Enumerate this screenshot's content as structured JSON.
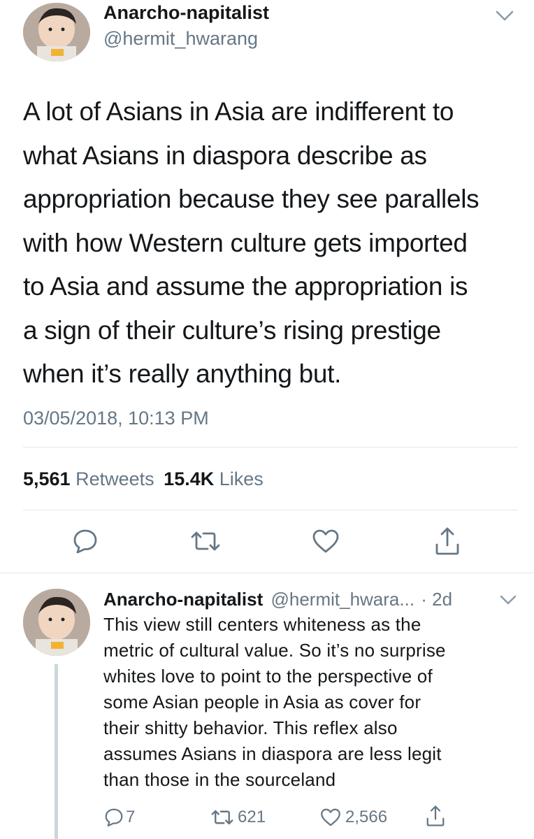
{
  "tweet": {
    "author_name": "Anarcho-napitalist",
    "author_handle": "@hermit_hwarang",
    "lines": [
      "A lot of Asians in Asia are indifferent to",
      "what Asians in diaspora describe as",
      "appropriation because they see parallels",
      "with how Western culture gets imported",
      "to Asia and assume the appropriation is",
      "a sign of their culture’s rising prestige",
      "when it’s really anything but."
    ],
    "timestamp": "03/05/2018, 10:13 PM",
    "retweets_count": "5,561",
    "retweets_label": "Retweets",
    "likes_count": "15.4K",
    "likes_label": "Likes"
  },
  "reply": {
    "author_name": "Anarcho-napitalist",
    "author_handle": "@hermit_hwara...",
    "age": "· 2d",
    "lines": [
      "This view still centers whiteness as the",
      "metric of cultural value. So it’s no surprise",
      "whites love to point to the perspective of",
      "some Asian people in Asia as cover for",
      "their shitty behavior. This reflex also",
      "assumes Asians in diaspora are less legit",
      "than those in the sourceland"
    ],
    "reply_count": "7",
    "retweet_count": "621",
    "like_count": "2,566"
  },
  "icons": {
    "reply": "speech-bubble-icon",
    "retweet": "retweet-arrows-icon",
    "like": "heart-icon",
    "share": "share-arrow-icon",
    "menu": "chevron-down-icon"
  },
  "colors": {
    "text": "#14171a",
    "secondary": "#657786",
    "divider": "#e1e8ed",
    "thread_line": "#ccd6dd"
  }
}
